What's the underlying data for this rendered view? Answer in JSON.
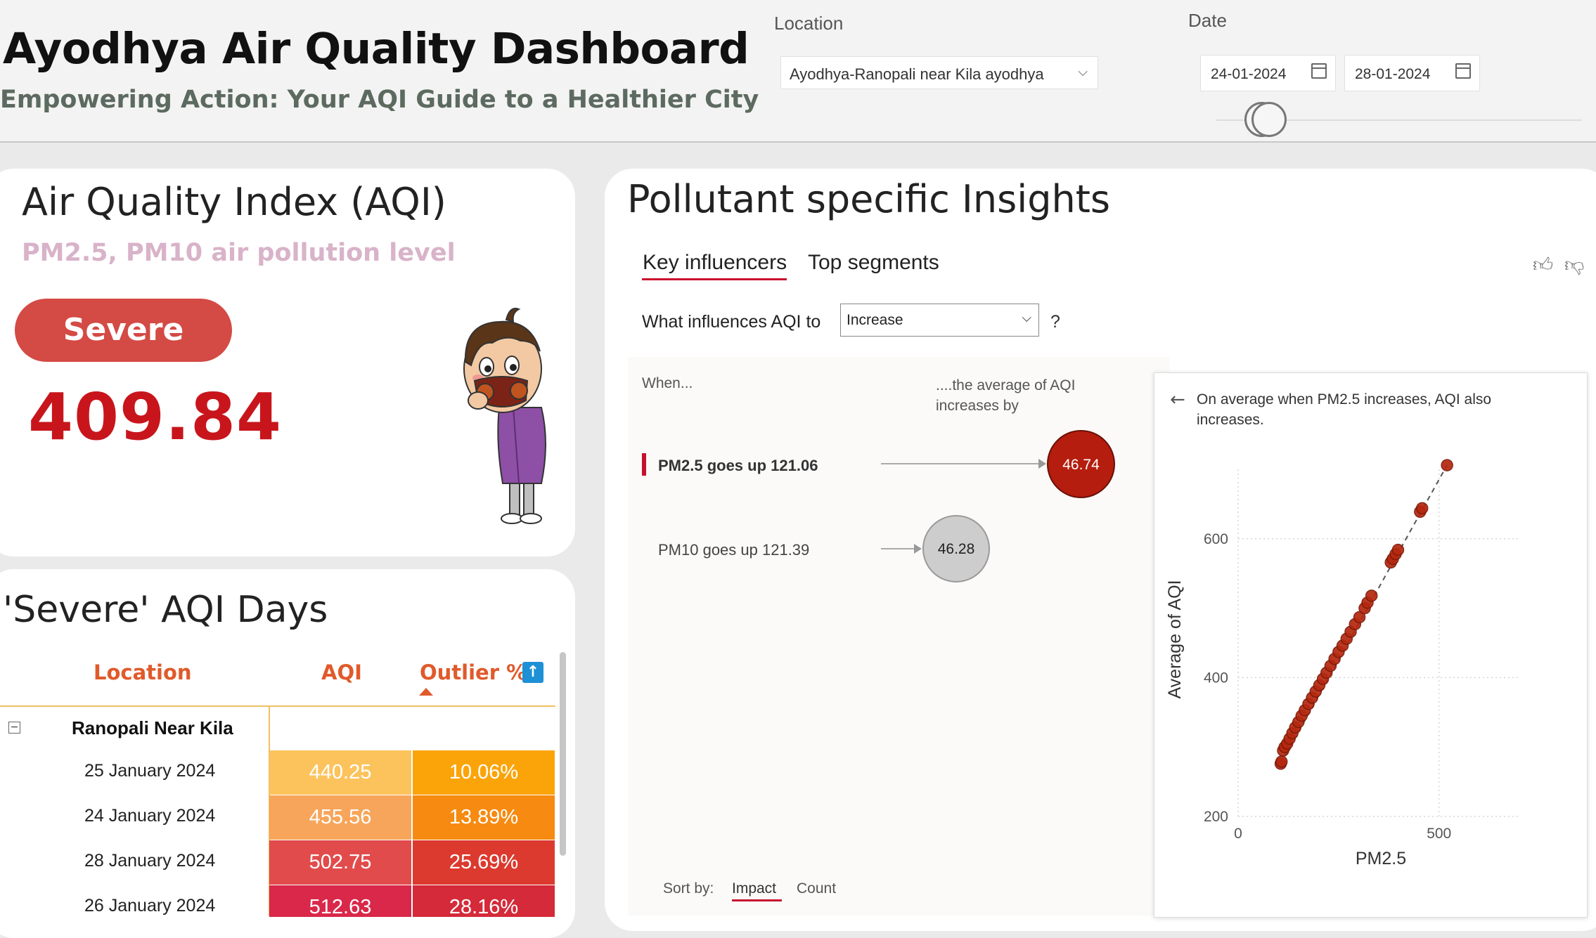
{
  "header": {
    "title": "Ayodhya Air Quality Dashboard",
    "subtitle": "Empowering Action: Your AQI Guide to a Healthier City",
    "location_label": "Location",
    "location_value": "Ayodhya-Ranopali near Kila ayodhya",
    "date_label": "Date",
    "date_from": "24-01-2024",
    "date_to": "28-01-2024"
  },
  "aqi_card": {
    "title": "Air Quality Index (AQI)",
    "subtitle": "PM2.5, PM10 air pollution level",
    "status": "Severe",
    "value": "409.84"
  },
  "severe_table": {
    "title": "'Severe' AQI Days",
    "headers": [
      "Location",
      "AQI",
      "Outlier %"
    ],
    "group": "Ranopali Near Kila",
    "rows": [
      {
        "date": "25 January 2024",
        "aqi": "440.25",
        "outlier": "10.06%",
        "aqi_color": "#fcc35c",
        "out_color": "#fba40a"
      },
      {
        "date": "24 January 2024",
        "aqi": "455.56",
        "outlier": "13.89%",
        "aqi_color": "#f7a55a",
        "out_color": "#f78a10"
      },
      {
        "date": "28 January 2024",
        "aqi": "502.75",
        "outlier": "25.69%",
        "aqi_color": "#e24b4b",
        "out_color": "#dc3a2e"
      },
      {
        "date": "26 January 2024",
        "aqi": "512.63",
        "outlier": "28.16%",
        "aqi_color": "#d9284a",
        "out_color": "#d42a3a"
      }
    ]
  },
  "insights": {
    "title": "Pollutant specific Insights",
    "tabs": [
      "Key influencers",
      "Top segments"
    ],
    "question_label": "What influences AQI to",
    "question_value": "Increase",
    "question_mark": "?",
    "when_label": "When...",
    "avg_label": "....the average of AQI increases by",
    "influencers": [
      {
        "label": "PM2.5 goes up 121.06",
        "value": "46.74"
      },
      {
        "label": "PM10 goes up 121.39",
        "value": "46.28"
      }
    ],
    "sort_label": "Sort by:",
    "sort_impact": "Impact",
    "sort_count": "Count",
    "detail_text": "On average when PM2.5 increases, AQI also increases."
  },
  "chart_data": {
    "type": "scatter",
    "xlabel": "PM2.5",
    "ylabel": "Average of AQI",
    "xlim": [
      0,
      700
    ],
    "ylim": [
      200,
      700
    ],
    "xticks": [
      "0",
      "500"
    ],
    "yticks": [
      "200",
      "400",
      "600"
    ],
    "points": [
      [
        106,
        276
      ],
      [
        108,
        279
      ],
      [
        112,
        295
      ],
      [
        116,
        300
      ],
      [
        122,
        305
      ],
      [
        128,
        312
      ],
      [
        135,
        320
      ],
      [
        142,
        328
      ],
      [
        150,
        336
      ],
      [
        158,
        345
      ],
      [
        166,
        353
      ],
      [
        175,
        362
      ],
      [
        184,
        371
      ],
      [
        193,
        380
      ],
      [
        202,
        389
      ],
      [
        211,
        398
      ],
      [
        220,
        407
      ],
      [
        230,
        417
      ],
      [
        240,
        427
      ],
      [
        250,
        437
      ],
      [
        260,
        446
      ],
      [
        270,
        456
      ],
      [
        280,
        466
      ],
      [
        291,
        477
      ],
      [
        302,
        487
      ],
      [
        315,
        500
      ],
      [
        322,
        508
      ],
      [
        332,
        518
      ],
      [
        380,
        566
      ],
      [
        385,
        571
      ],
      [
        392,
        578
      ],
      [
        398,
        584
      ],
      [
        453,
        639
      ],
      [
        458,
        644
      ],
      [
        520,
        706
      ]
    ]
  },
  "colors": {
    "accent": "#c8102e",
    "severe": "#d44a44",
    "value": "#c8151c",
    "header_orange": "#e05a2b",
    "bubble_main": "#b51d0e",
    "scatter_point": "#b5280f"
  }
}
